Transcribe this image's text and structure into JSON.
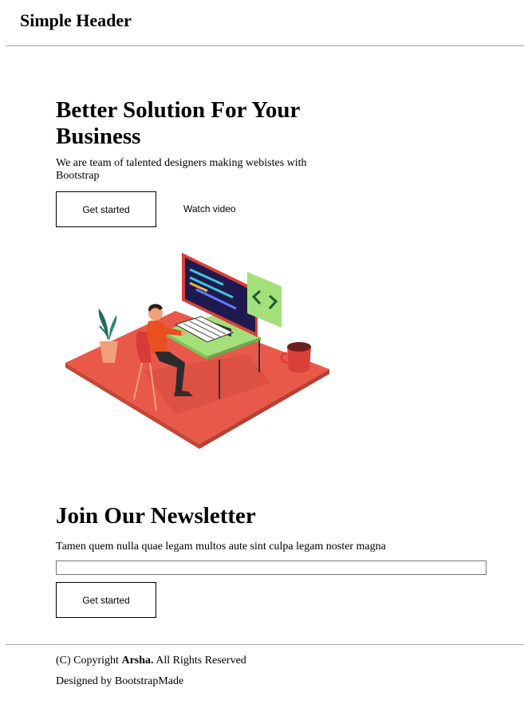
{
  "header": {
    "title": "Simple Header"
  },
  "hero": {
    "title": "Better Solution For Your Business",
    "subtitle": "We are team of talented designers making webistes with Bootstrap",
    "primary_button": "Get started",
    "secondary_link": "Watch video"
  },
  "illustration": {
    "subject": "person working at computer desk",
    "colors": {
      "floor": "#e8594a",
      "desk_top": "#a3e07a",
      "monitor_frame": "#d9403a",
      "screen": "#1f1a4d",
      "code_card": "#a3e07a",
      "shirt": "#e8501f"
    }
  },
  "newsletter": {
    "title": "Join Our Newsletter",
    "text": "Tamen quem nulla quae legam multos aute sint culpa legam noster magna",
    "input_value": "",
    "button": "Get started"
  },
  "footer": {
    "copyright_prefix": "(C) Copyright",
    "brand": "Arsha.",
    "copyright_suffix": "All Rights Reserved",
    "designed_by": "Designed by BootstrapMade"
  }
}
